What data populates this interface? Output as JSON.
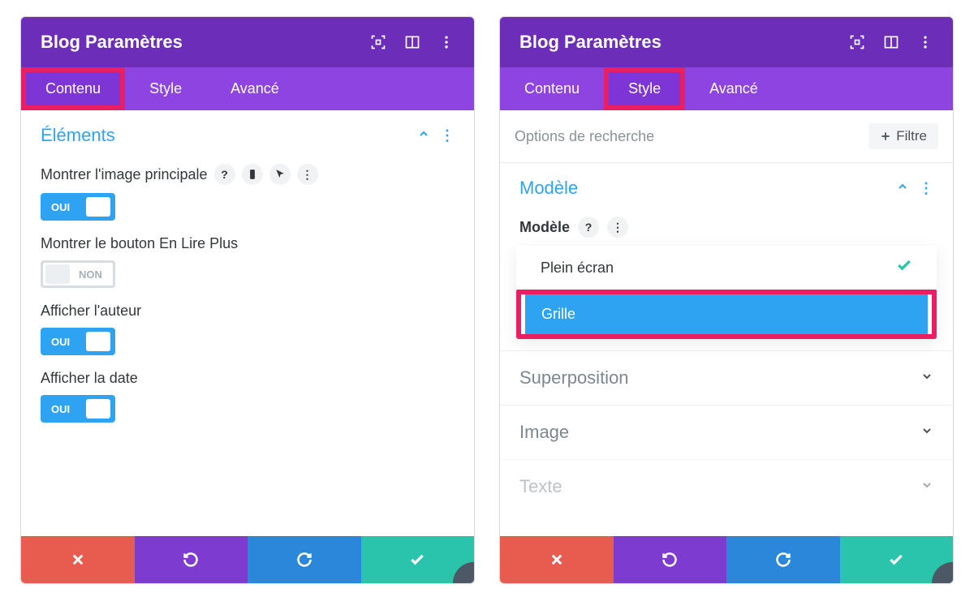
{
  "header": {
    "title": "Blog Paramètres"
  },
  "tabs": {
    "content": "Contenu",
    "style": "Style",
    "advanced": "Avancé"
  },
  "panel_left": {
    "section_title": "Éléments",
    "options": {
      "show_featured_image": {
        "label": "Montrer l'image principale",
        "value_on": "OUI"
      },
      "show_read_more": {
        "label": "Montrer le bouton En Lire Plus",
        "value_off": "NON"
      },
      "show_author": {
        "label": "Afficher l'auteur",
        "value_on": "OUI"
      },
      "show_date": {
        "label": "Afficher la date",
        "value_on": "OUI"
      }
    }
  },
  "panel_right": {
    "search_placeholder": "Options de recherche",
    "filter_label": "Filtre",
    "section_title": "Modèle",
    "field_label": "Modèle",
    "dropdown": {
      "option_fullscreen": "Plein écran",
      "option_grid": "Grille"
    },
    "collapsed": {
      "overlay": "Superposition",
      "image": "Image",
      "text": "Texte"
    }
  }
}
